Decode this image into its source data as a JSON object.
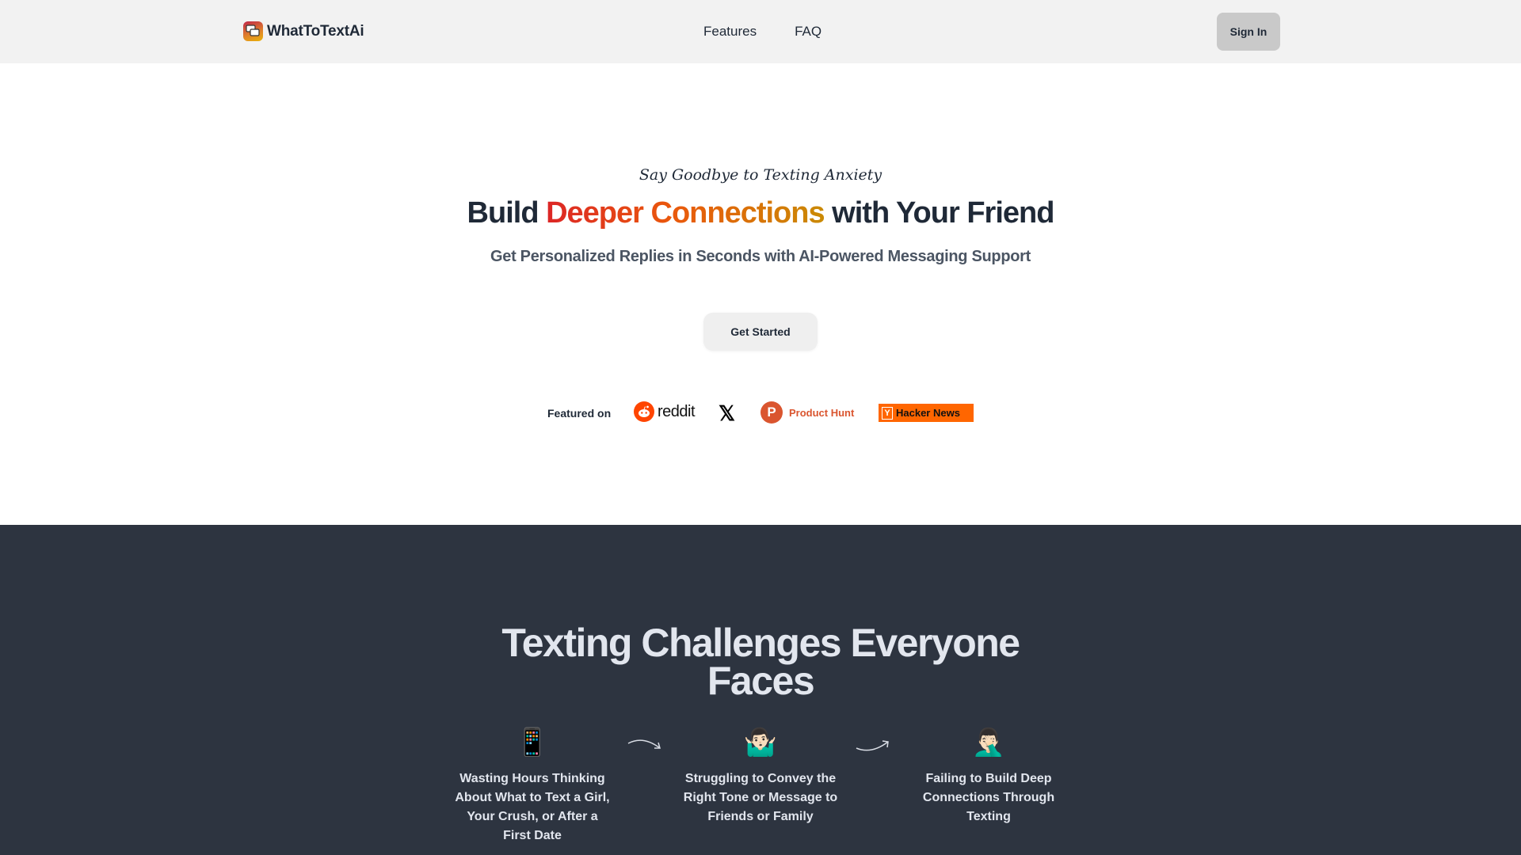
{
  "navbar": {
    "brand": "WhatToTextAi",
    "links": [
      "Features",
      "FAQ"
    ],
    "signin_label": "Sign In"
  },
  "hero": {
    "tagline": "Say Goodbye to Texting Anxiety",
    "headline_pre": "Build ",
    "headline_highlight": "Deeper Connections",
    "headline_post": " with Your Friend",
    "subhead": "Get Personalized Replies in Seconds with AI-Powered Messaging Support",
    "cta_label": "Get Started",
    "featured_label": "Featured on",
    "featured": {
      "reddit": "reddit",
      "x": "𝕏",
      "producthunt": "Product Hunt",
      "producthunt_letter": "P",
      "hackernews": "Hacker News",
      "hackernews_letter": "Y"
    },
    "colors": {
      "gradient_start": "#dc2626",
      "gradient_mid": "#ea580c",
      "gradient_end": "#ca8a04"
    }
  },
  "challenges": {
    "title": "Texting Challenges Everyone Faces",
    "items": [
      {
        "icon": "📱",
        "text": "Wasting Hours Thinking About What to Text a Girl, Your Crush, or After a First Date"
      },
      {
        "icon": "🤷🏻‍♂️",
        "text": "Struggling to Convey the Right Tone or Message to Friends or Family"
      },
      {
        "icon": "🤦🏻‍♂️",
        "text": "Failing to Build Deep Connections Through Texting"
      }
    ]
  }
}
